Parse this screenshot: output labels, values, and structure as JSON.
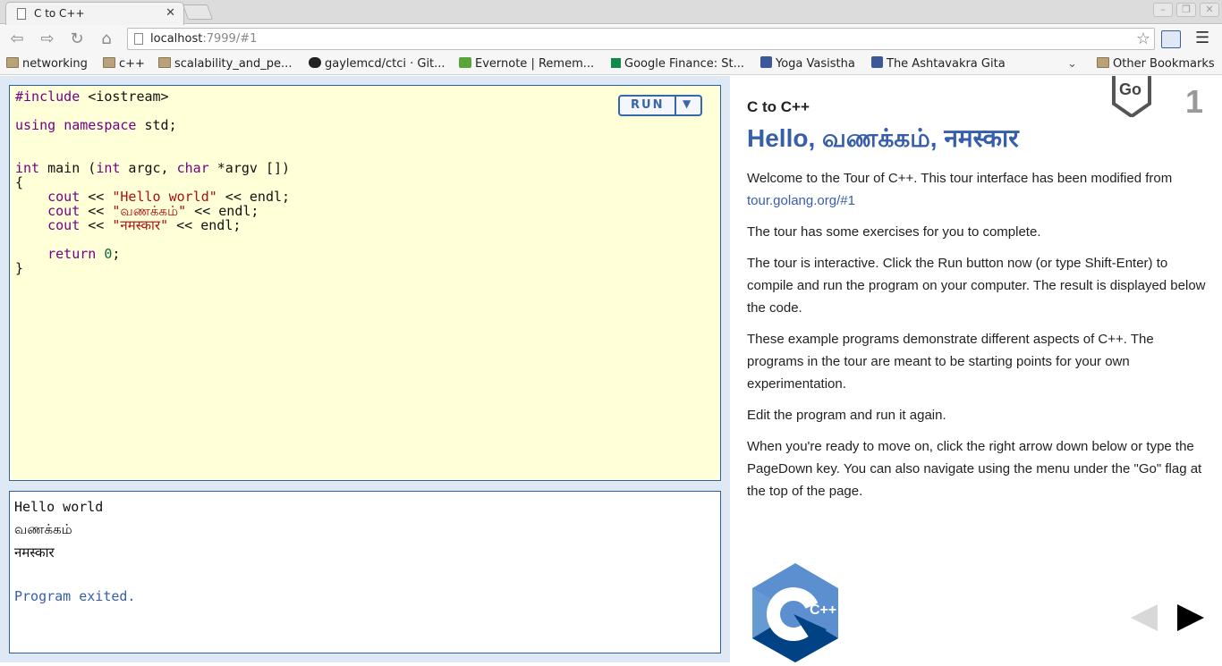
{
  "browser": {
    "tab_title": "C to C++",
    "url_host": "localhost",
    "url_rest": ":7999/#1",
    "bookmarks": [
      {
        "label": "networking",
        "icon": "folder-icon"
      },
      {
        "label": "c++",
        "icon": "folder-icon"
      },
      {
        "label": "scalability_and_pe...",
        "icon": "folder-icon"
      },
      {
        "label": "gaylemcd/ctci · Git...",
        "icon": "github-icon"
      },
      {
        "label": "Evernote | Remem...",
        "icon": "evernote-icon"
      },
      {
        "label": "Google Finance: St...",
        "icon": "google-finance-icon"
      },
      {
        "label": "Yoga Vasistha",
        "icon": "facebook-icon"
      },
      {
        "label": "The Ashtavakra Gita",
        "icon": "facebook-icon"
      }
    ],
    "other_bookmarks": "Other Bookmarks"
  },
  "editor": {
    "run_label": "RUN",
    "run_menu_arrow": "▼",
    "code": {
      "l1_a": "#include",
      "l1_b": " <iostream>",
      "l2_a": "using",
      "l2_b": " ",
      "l2_c": "namespace",
      "l2_d": " std;",
      "l3_a": "int",
      "l3_b": " main (",
      "l3_c": "int",
      "l3_d": " argc, ",
      "l3_e": "char",
      "l3_f": " *argv [])",
      "l4": "{",
      "l5_a": "    cout",
      "l5_b": " << ",
      "l5_c": "\"Hello world\"",
      "l5_d": " << endl;",
      "l6_a": "    cout",
      "l6_b": " << ",
      "l6_c": "\"வணக்கம்\"",
      "l6_d": " << endl;",
      "l7_a": "    cout",
      "l7_b": " << ",
      "l7_c": "\"नमस्कार\"",
      "l7_d": " << endl;",
      "l8_a": "    return",
      "l8_b": " ",
      "l8_c": "0",
      "l8_d": ";",
      "l9": "}"
    }
  },
  "output": {
    "line1": "Hello world",
    "line2": "வணக்கம்",
    "line3": "नमस्कार",
    "exited": "Program exited."
  },
  "lesson": {
    "go_badge": "Go",
    "page_number": "1",
    "section": "C to C++",
    "heading": "Hello, வணக்கம், नमस्कार",
    "p1_text": "Welcome to the Tour of C++. This tour interface has been modified from ",
    "p1_link": "tour.golang.org/#1",
    "p2": "The tour has some exercises for you to complete.",
    "p3": "The tour is interactive. Click the Run button now (or type Shift-Enter) to compile and run the program on your computer. The result is displayed below the code.",
    "p4": "These example programs demonstrate different aspects of C++. The programs in the tour are meant to be starting points for your own experimentation.",
    "p5": "Edit the program and run it again.",
    "p6": "When you're ready to move on, click the right arrow down below or type the PageDown key. You can also navigate using the menu under the \"Go\" flag at the top of the page.",
    "logo_text": "C++"
  },
  "colors": {
    "editor_bg": "#ffffd8",
    "pane_bg": "#dee9f5",
    "accent": "#375eab"
  }
}
